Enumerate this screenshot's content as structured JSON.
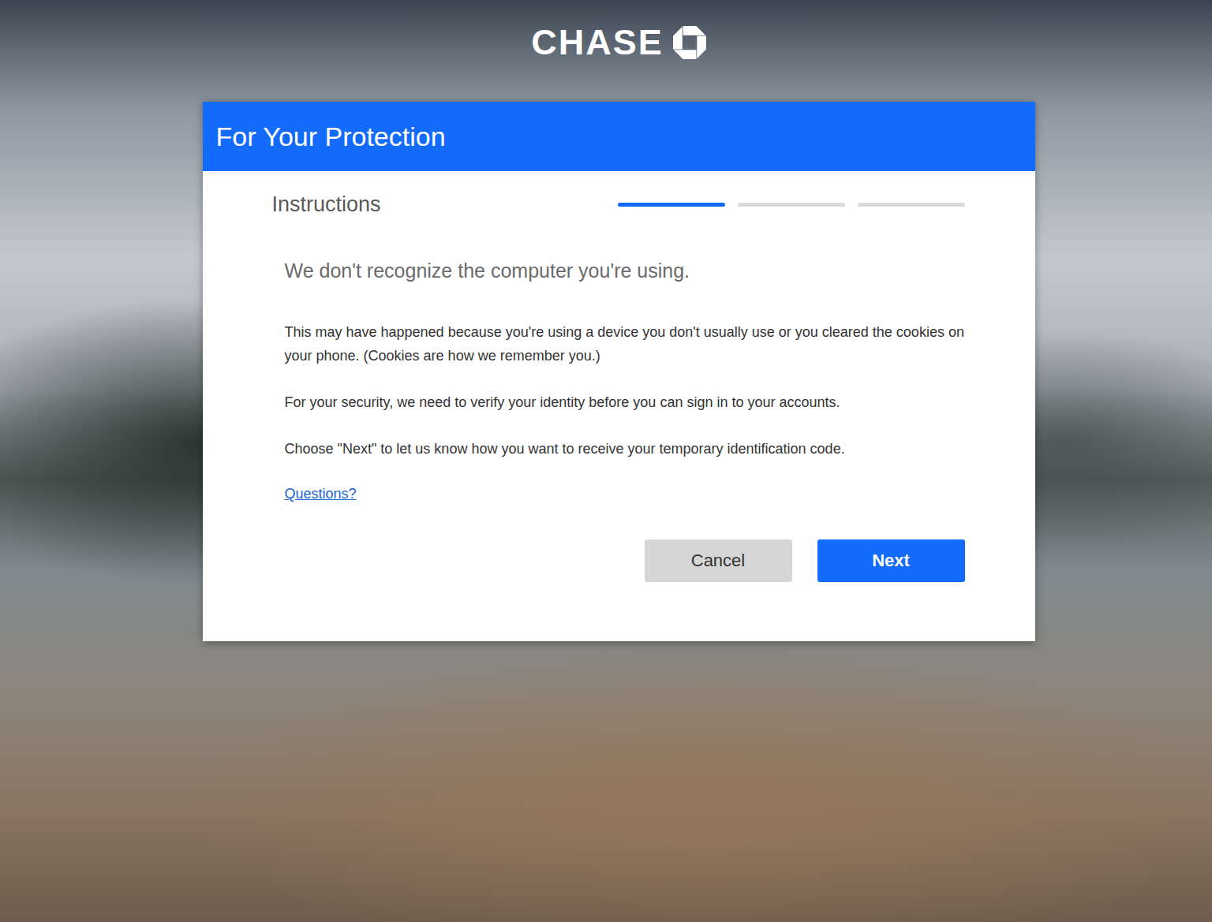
{
  "brand": {
    "name": "CHASE"
  },
  "dialog": {
    "title": "For Your Protection",
    "step_label": "Instructions",
    "steps": [
      {
        "selected": true
      },
      {
        "selected": false
      },
      {
        "selected": false
      }
    ],
    "heading": "We don't recognize the computer you're using.",
    "paragraphs": [
      "This may have happened because you're using a device you don't usually use or you cleared the cookies on your phone. (Cookies are how we remember you.)",
      "For your security, we need to verify your identity before you can sign in to your accounts.",
      "Choose \"Next\" to let us know how you want to receive your temporary identification code."
    ],
    "link": "Questions?",
    "buttons": [
      {
        "label": "Cancel",
        "kind": "secondary"
      },
      {
        "label": "Next",
        "kind": "primary"
      }
    ]
  }
}
